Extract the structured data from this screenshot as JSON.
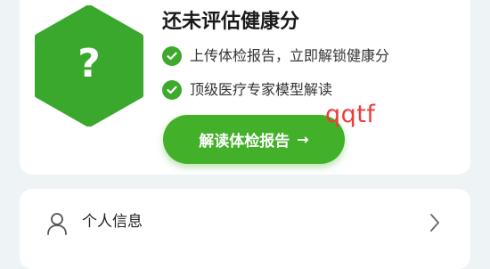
{
  "health_card": {
    "title": "还未评估健康分",
    "hex_mark": "?",
    "features": [
      "上传体检报告，立即解锁健康分",
      "顶级医疗专家模型解读"
    ],
    "cta_label": "解读体检报告",
    "cta_arrow": "→",
    "watermark": "qqtf"
  },
  "profile_row": {
    "label": "个人信息",
    "icon": "person-icon",
    "chevron": "chevron-right-icon"
  },
  "colors": {
    "accent_green": "#43b02a",
    "hexagon_green": "#3aa82c",
    "watermark_red": "#f03a3a",
    "background": "#eef3f5"
  }
}
